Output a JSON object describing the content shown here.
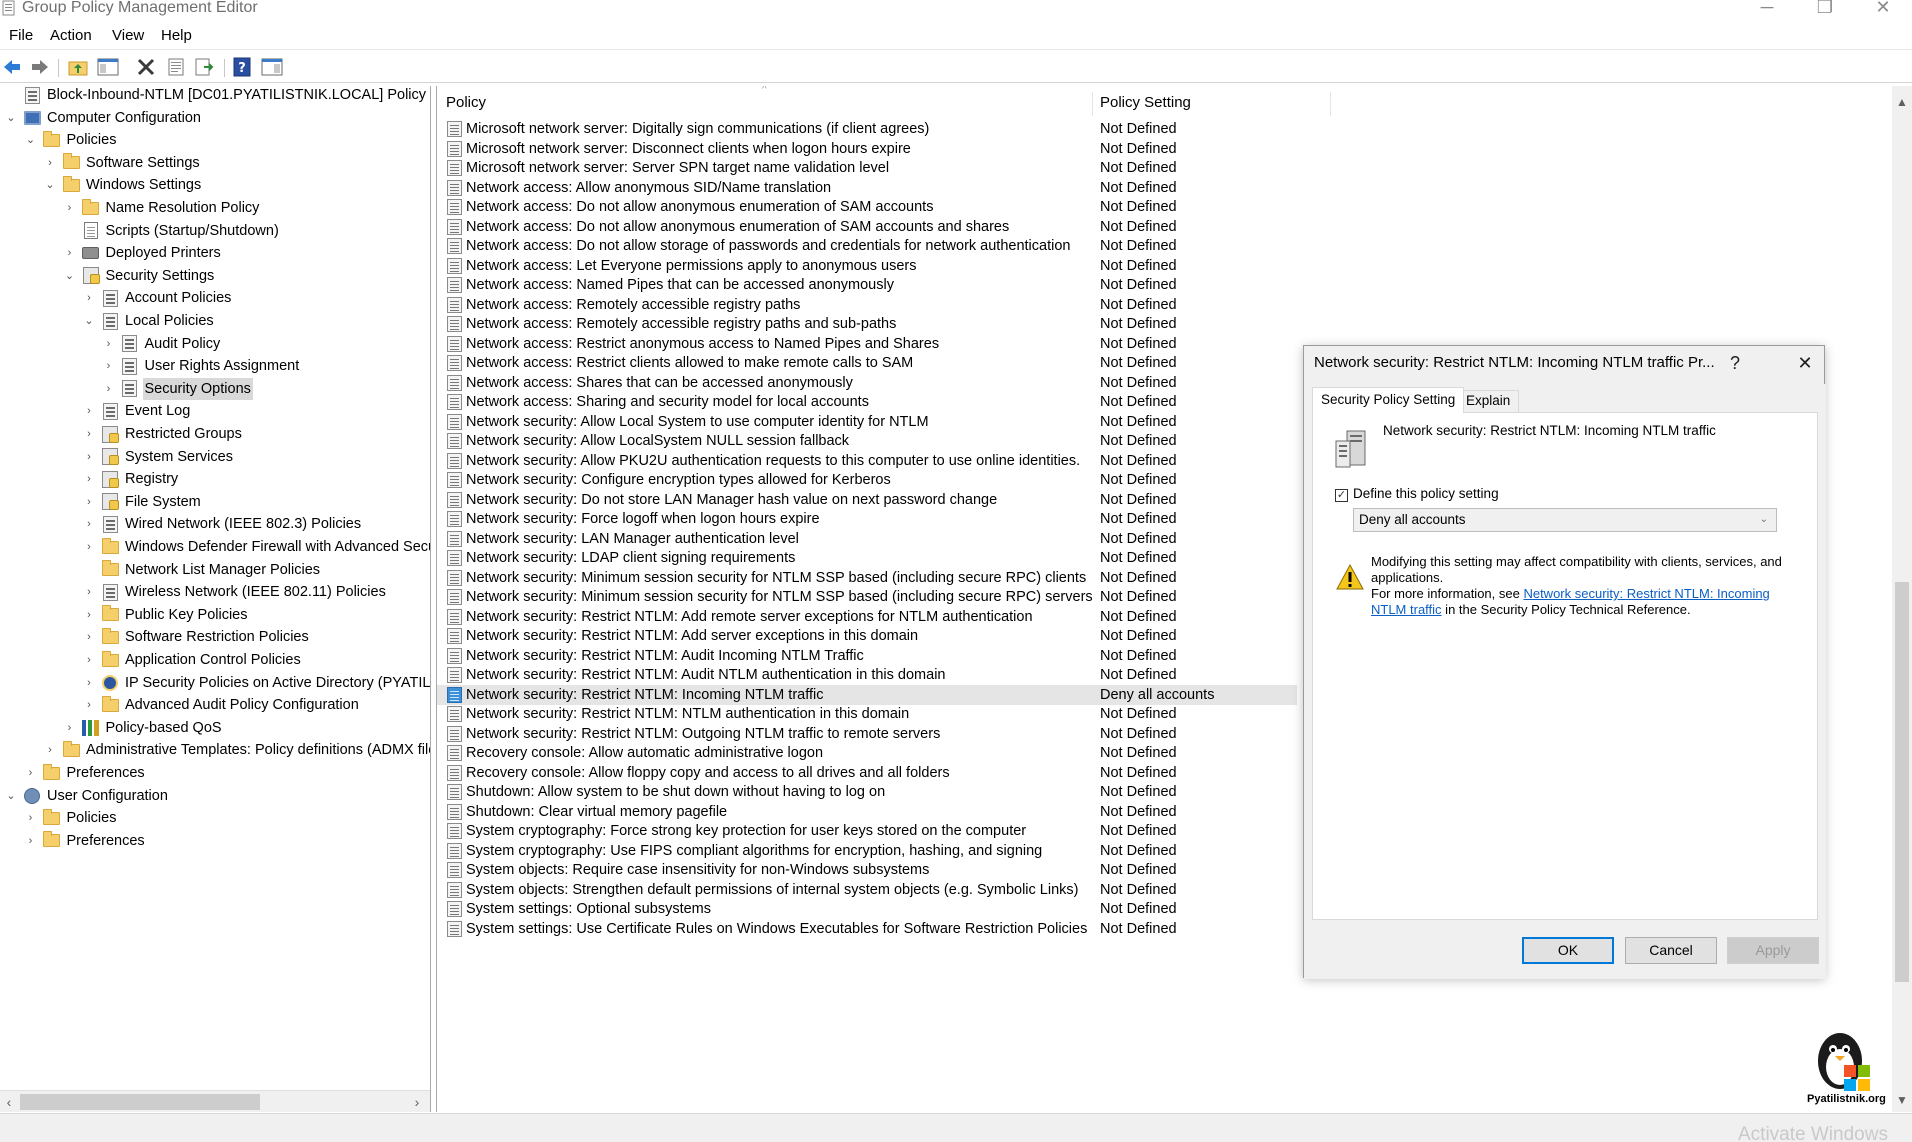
{
  "window": {
    "title": "Group Policy Management Editor",
    "controls": [
      "minimize",
      "restore",
      "close"
    ]
  },
  "menu": [
    {
      "label": "File"
    },
    {
      "label": "Action"
    },
    {
      "label": "View"
    },
    {
      "label": "Help"
    }
  ],
  "toolbar": [
    {
      "name": "back-button",
      "icon": "arrow-left-icon"
    },
    {
      "name": "forward-button",
      "icon": "arrow-right-icon"
    },
    {
      "name": "up-folder-button",
      "icon": "folder-up-icon"
    },
    {
      "name": "show-hide-tree-button",
      "icon": "console-tree-icon"
    },
    {
      "name": "delete-button",
      "icon": "delete-x-icon"
    },
    {
      "name": "properties-button",
      "icon": "properties-icon"
    },
    {
      "name": "export-list-button",
      "icon": "export-icon"
    },
    {
      "name": "help-button",
      "icon": "help-icon"
    },
    {
      "name": "action-pane-button",
      "icon": "action-pane-icon"
    }
  ],
  "tree": {
    "nodes": [
      {
        "label": "Block-Inbound-NTLM [DC01.PYATILISTNIK.LOCAL] Policy",
        "level": 0,
        "icon": "policy-icon",
        "expanded": null
      },
      {
        "label": "Computer Configuration",
        "level": 0,
        "icon": "computer-icon",
        "expanded": true
      },
      {
        "label": "Policies",
        "level": 1,
        "icon": "folder-icon",
        "expanded": true
      },
      {
        "label": "Software Settings",
        "level": 2,
        "icon": "folder-icon",
        "expanded": false
      },
      {
        "label": "Windows Settings",
        "level": 2,
        "icon": "folder-icon",
        "expanded": true
      },
      {
        "label": "Name Resolution Policy",
        "level": 3,
        "icon": "folder-icon",
        "expanded": false
      },
      {
        "label": "Scripts (Startup/Shutdown)",
        "level": 3,
        "icon": "script-icon",
        "expanded": null
      },
      {
        "label": "Deployed Printers",
        "level": 3,
        "icon": "printer-icon",
        "expanded": false
      },
      {
        "label": "Security Settings",
        "level": 3,
        "icon": "security-icon",
        "expanded": true
      },
      {
        "label": "Account Policies",
        "level": 4,
        "icon": "policy-icon",
        "expanded": false
      },
      {
        "label": "Local Policies",
        "level": 4,
        "icon": "policy-icon",
        "expanded": true
      },
      {
        "label": "Audit Policy",
        "level": 5,
        "icon": "policy-icon",
        "expanded": false
      },
      {
        "label": "User Rights Assignment",
        "level": 5,
        "icon": "policy-icon",
        "expanded": false
      },
      {
        "label": "Security Options",
        "level": 5,
        "icon": "policy-icon",
        "expanded": false,
        "selected": true
      },
      {
        "label": "Event Log",
        "level": 4,
        "icon": "policy-icon",
        "expanded": false
      },
      {
        "label": "Restricted Groups",
        "level": 4,
        "icon": "security-icon",
        "expanded": false
      },
      {
        "label": "System Services",
        "level": 4,
        "icon": "security-icon",
        "expanded": false
      },
      {
        "label": "Registry",
        "level": 4,
        "icon": "security-icon",
        "expanded": false
      },
      {
        "label": "File System",
        "level": 4,
        "icon": "security-icon",
        "expanded": false
      },
      {
        "label": "Wired Network (IEEE 802.3) Policies",
        "level": 4,
        "icon": "policy-icon",
        "expanded": false
      },
      {
        "label": "Windows Defender Firewall with Advanced Security",
        "level": 4,
        "icon": "folder-icon",
        "expanded": false
      },
      {
        "label": "Network List Manager Policies",
        "level": 4,
        "icon": "folder-icon",
        "expanded": null
      },
      {
        "label": "Wireless Network (IEEE 802.11) Policies",
        "level": 4,
        "icon": "policy-icon",
        "expanded": false
      },
      {
        "label": "Public Key Policies",
        "level": 4,
        "icon": "folder-icon",
        "expanded": false
      },
      {
        "label": "Software Restriction Policies",
        "level": 4,
        "icon": "folder-icon",
        "expanded": false
      },
      {
        "label": "Application Control Policies",
        "level": 4,
        "icon": "folder-icon",
        "expanded": false
      },
      {
        "label": "IP Security Policies on Active Directory (PYATILISTNIK.LOCAL)",
        "level": 4,
        "icon": "ipsec-icon",
        "expanded": false
      },
      {
        "label": "Advanced Audit Policy Configuration",
        "level": 4,
        "icon": "folder-icon",
        "expanded": false
      },
      {
        "label": "Policy-based QoS",
        "level": 3,
        "icon": "qos-icon",
        "expanded": false
      },
      {
        "label": "Administrative Templates: Policy definitions (ADMX files)",
        "level": 2,
        "icon": "folder-icon",
        "expanded": false
      },
      {
        "label": "Preferences",
        "level": 1,
        "icon": "folder-icon",
        "expanded": false
      },
      {
        "label": "User Configuration",
        "level": 0,
        "icon": "user-icon",
        "expanded": true
      },
      {
        "label": "Policies",
        "level": 1,
        "icon": "folder-icon",
        "expanded": false
      },
      {
        "label": "Preferences",
        "level": 1,
        "icon": "folder-icon",
        "expanded": false
      }
    ]
  },
  "list": {
    "columns": [
      "Policy",
      "Policy Setting"
    ],
    "rows": [
      {
        "policy": "Microsoft network server: Digitally sign communications (if client agrees)",
        "setting": "Not Defined"
      },
      {
        "policy": "Microsoft network server: Disconnect clients when logon hours expire",
        "setting": "Not Defined"
      },
      {
        "policy": "Microsoft network server: Server SPN target name validation level",
        "setting": "Not Defined"
      },
      {
        "policy": "Network access: Allow anonymous SID/Name translation",
        "setting": "Not Defined"
      },
      {
        "policy": "Network access: Do not allow anonymous enumeration of SAM accounts",
        "setting": "Not Defined"
      },
      {
        "policy": "Network access: Do not allow anonymous enumeration of SAM accounts and shares",
        "setting": "Not Defined"
      },
      {
        "policy": "Network access: Do not allow storage of passwords and credentials for network authentication",
        "setting": "Not Defined"
      },
      {
        "policy": "Network access: Let Everyone permissions apply to anonymous users",
        "setting": "Not Defined"
      },
      {
        "policy": "Network access: Named Pipes that can be accessed anonymously",
        "setting": "Not Defined"
      },
      {
        "policy": "Network access: Remotely accessible registry paths",
        "setting": "Not Defined"
      },
      {
        "policy": "Network access: Remotely accessible registry paths and sub-paths",
        "setting": "Not Defined"
      },
      {
        "policy": "Network access: Restrict anonymous access to Named Pipes and Shares",
        "setting": "Not Defined"
      },
      {
        "policy": "Network access: Restrict clients allowed to make remote calls to SAM",
        "setting": "Not Defined"
      },
      {
        "policy": "Network access: Shares that can be accessed anonymously",
        "setting": "Not Defined"
      },
      {
        "policy": "Network access: Sharing and security model for local accounts",
        "setting": "Not Defined"
      },
      {
        "policy": "Network security: Allow Local System to use computer identity for NTLM",
        "setting": "Not Defined"
      },
      {
        "policy": "Network security: Allow LocalSystem NULL session fallback",
        "setting": "Not Defined"
      },
      {
        "policy": "Network security: Allow PKU2U authentication requests to this computer to use online identities.",
        "setting": "Not Defined"
      },
      {
        "policy": "Network security: Configure encryption types allowed for Kerberos",
        "setting": "Not Defined"
      },
      {
        "policy": "Network security: Do not store LAN Manager hash value on next password change",
        "setting": "Not Defined"
      },
      {
        "policy": "Network security: Force logoff when logon hours expire",
        "setting": "Not Defined"
      },
      {
        "policy": "Network security: LAN Manager authentication level",
        "setting": "Not Defined"
      },
      {
        "policy": "Network security: LDAP client signing requirements",
        "setting": "Not Defined"
      },
      {
        "policy": "Network security: Minimum session security for NTLM SSP based (including secure RPC) clients",
        "setting": "Not Defined"
      },
      {
        "policy": "Network security: Minimum session security for NTLM SSP based (including secure RPC) servers",
        "setting": "Not Defined"
      },
      {
        "policy": "Network security: Restrict NTLM: Add remote server exceptions for NTLM authentication",
        "setting": "Not Defined"
      },
      {
        "policy": "Network security: Restrict NTLM: Add server exceptions in this domain",
        "setting": "Not Defined"
      },
      {
        "policy": "Network security: Restrict NTLM: Audit Incoming NTLM Traffic",
        "setting": "Not Defined"
      },
      {
        "policy": "Network security: Restrict NTLM: Audit NTLM authentication in this domain",
        "setting": "Not Defined"
      },
      {
        "policy": "Network security: Restrict NTLM: Incoming NTLM traffic",
        "setting": "Deny all accounts",
        "selected": true
      },
      {
        "policy": "Network security: Restrict NTLM: NTLM authentication in this domain",
        "setting": "Not Defined"
      },
      {
        "policy": "Network security: Restrict NTLM: Outgoing NTLM traffic to remote servers",
        "setting": "Not Defined"
      },
      {
        "policy": "Recovery console: Allow automatic administrative logon",
        "setting": "Not Defined"
      },
      {
        "policy": "Recovery console: Allow floppy copy and access to all drives and all folders",
        "setting": "Not Defined"
      },
      {
        "policy": "Shutdown: Allow system to be shut down without having to log on",
        "setting": "Not Defined"
      },
      {
        "policy": "Shutdown: Clear virtual memory pagefile",
        "setting": "Not Defined"
      },
      {
        "policy": "System cryptography: Force strong key protection for user keys stored on the computer",
        "setting": "Not Defined"
      },
      {
        "policy": "System cryptography: Use FIPS compliant algorithms for encryption, hashing, and signing",
        "setting": "Not Defined"
      },
      {
        "policy": "System objects: Require case insensitivity for non-Windows subsystems",
        "setting": "Not Defined"
      },
      {
        "policy": "System objects: Strengthen default permissions of internal system objects (e.g. Symbolic Links)",
        "setting": "Not Defined"
      },
      {
        "policy": "System settings: Optional subsystems",
        "setting": "Not Defined"
      },
      {
        "policy": "System settings: Use Certificate Rules on Windows Executables for Software Restriction Policies",
        "setting": "Not Defined"
      }
    ]
  },
  "dialog": {
    "title": "Network security: Restrict NTLM: Incoming NTLM traffic Pr...",
    "help_label": "?",
    "tabs": [
      {
        "label": "Security Policy Setting",
        "active": true
      },
      {
        "label": "Explain",
        "active": false
      }
    ],
    "policy_name": "Network security: Restrict NTLM: Incoming NTLM traffic",
    "define_checkbox": {
      "label": "Define this policy setting",
      "checked": true
    },
    "selected_option": "Deny all accounts",
    "warning": {
      "text_line1": "Modifying this setting may affect compatibility with clients, services, and applications.",
      "text_line2_prefix": "For more information, see ",
      "link_text": "Network security: Restrict NTLM: Incoming NTLM traffic",
      "text_line2_suffix": " in the Security Policy Technical Reference."
    },
    "buttons": {
      "ok": "OK",
      "cancel": "Cancel",
      "apply": "Apply"
    }
  },
  "logo": {
    "text": "Pyatilistnik.org"
  },
  "watermark": "Activate Windows",
  "colors": {
    "selection_gray": "#e5e5e5",
    "link_blue": "#0a5fc4",
    "default_button_border": "#0078d7",
    "folder_yellow": "#f4cf6b"
  }
}
